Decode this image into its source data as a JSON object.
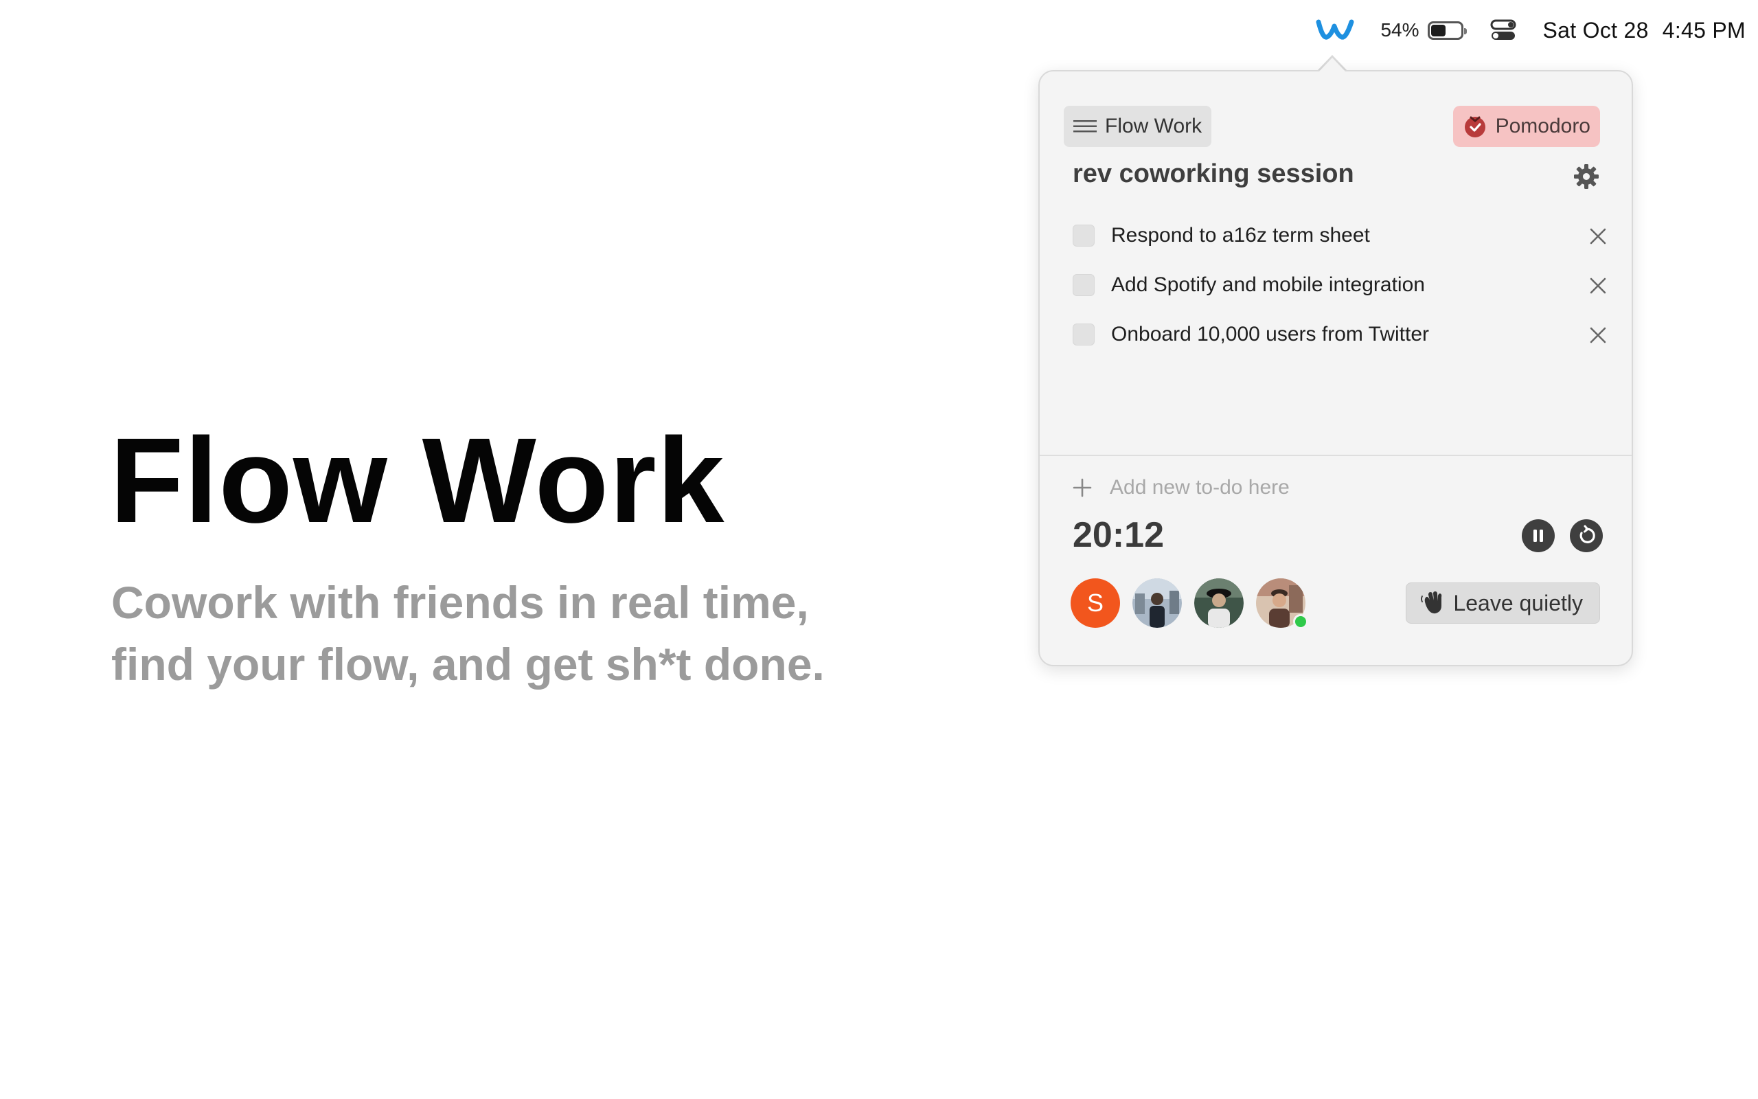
{
  "menubar": {
    "app_icon": "flow-w-logo-icon",
    "battery_percent": "54%",
    "battery_level": 0.54,
    "control_center_icon": "control-center-icon",
    "date": "Sat Oct 28",
    "time": "4:45 PM"
  },
  "hero": {
    "title": "Flow Work",
    "subtitle_line1": "Cowork with friends in real time,",
    "subtitle_line2": "find your flow, and get sh*t done."
  },
  "popover": {
    "menu_chip_label": "Flow Work",
    "menu_chip_icon": "hamburger-icon",
    "mode_chip_label": "Pomodoro",
    "mode_chip_icon": "pomodoro-timer-icon",
    "session_title": "rev coworking session",
    "settings_icon": "gear-icon",
    "todos": [
      {
        "label": "Respond to a16z term sheet",
        "checked": false
      },
      {
        "label": "Add Spotify and mobile integration",
        "checked": false
      },
      {
        "label": "Onboard 10,000 users from Twitter",
        "checked": false
      }
    ],
    "add_todo_placeholder": "Add new to-do here",
    "timer": "20:12",
    "participants": [
      {
        "initial": "S",
        "color": "#f2561d",
        "online": false
      },
      {
        "initial": "",
        "online": false
      },
      {
        "initial": "",
        "online": false
      },
      {
        "initial": "",
        "online": true
      }
    ],
    "leave_button_label": "Leave quietly",
    "leave_button_icon": "waving-hand-icon"
  },
  "colors": {
    "pomodoro_chip_bg": "#f6c3c3",
    "accent_logo": "#1e90e0",
    "online_green": "#2fc94a",
    "subtitle_gray": "#9b9b9b"
  }
}
